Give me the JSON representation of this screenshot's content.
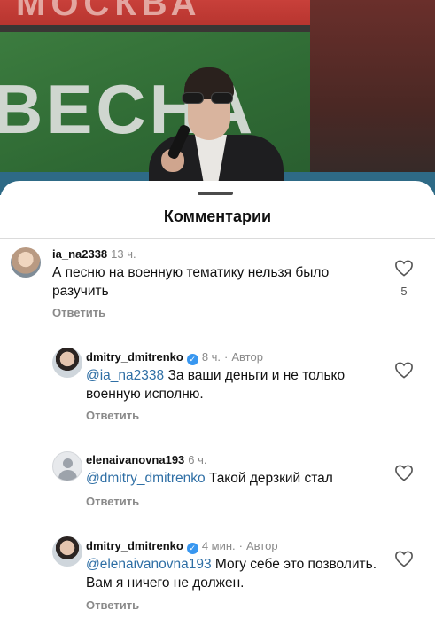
{
  "background": {
    "banner_top_text": "МОСКВА",
    "banner_word": "ВЕСНА"
  },
  "sheet": {
    "title": "Комментарии"
  },
  "comments": [
    {
      "username": "ia_na2338",
      "time": "13 ч.",
      "text": "А песню на военную тематику нельзя было разучить",
      "reply_label": "Ответить",
      "likes": "5",
      "avatar": "user-avatar"
    }
  ],
  "replies": [
    {
      "username": "dmitry_dmitrenko",
      "verified": true,
      "time": "8 ч.",
      "separator": "·",
      "author_label": "Автор",
      "mention": "@ia_na2338",
      "text": " За ваши деньги и не только военную исполню.",
      "reply_label": "Ответить",
      "avatar": "author-avatar"
    },
    {
      "username": "elenaivanovna193",
      "verified": false,
      "time": "6 ч.",
      "mention": "@dmitry_dmitrenko",
      "text": " Такой дерзкий стал",
      "reply_label": "Ответить",
      "avatar": "default-avatar"
    },
    {
      "username": "dmitry_dmitrenko",
      "verified": true,
      "time": "4 мин.",
      "separator": "·",
      "author_label": "Автор",
      "mention": "@elenaivanovna193",
      "text": " Могу себе это позволить. Вам я ничего не должен.",
      "reply_label": "Ответить",
      "avatar": "author-avatar"
    }
  ],
  "icons": {
    "like": "heart-outline-icon",
    "verified": "verified-badge-icon",
    "verified_glyph": "✓"
  },
  "colors": {
    "mention": "#2f6fa5",
    "verified": "#3897f0",
    "meta": "#8a8a8a"
  }
}
